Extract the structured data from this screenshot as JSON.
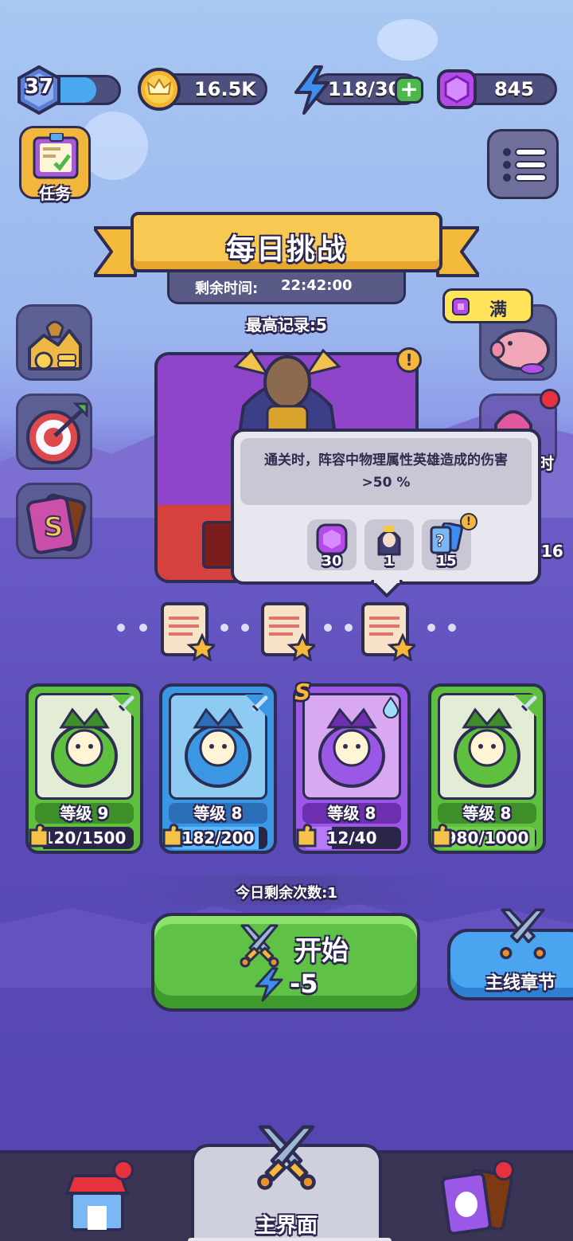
{
  "player": {
    "level": "37",
    "xp_fraction": 0.72
  },
  "resources": {
    "gold": "16.5K",
    "energy": "118/30",
    "gems": "845"
  },
  "left_buttons": {
    "tasks_label": "任务"
  },
  "title_banner": {
    "title": "每日挑战",
    "time_label": "剩余时间:",
    "time_value": "22:42:00"
  },
  "best_record": "最高记录:5",
  "piggy_bank": {
    "label": "满"
  },
  "tooltip": {
    "text": "通关时，阵容中物理属性英雄造成的伤害>50 %",
    "rewards": [
      {
        "icon": "purple-gem-icon",
        "count": "30"
      },
      {
        "icon": "hero-shard-icon",
        "count": "1"
      },
      {
        "icon": "mystery-card-icon",
        "count": "15"
      }
    ]
  },
  "side_partial_text": "时",
  "side_partial_number": "16",
  "hero_cards": [
    {
      "level": "等级 9",
      "progress": "120/1500",
      "fraction": 0.08,
      "theme": "green",
      "rank_badge": ""
    },
    {
      "level": "等级 8",
      "progress": "182/200",
      "fraction": 0.91,
      "theme": "blue",
      "rank_badge": ""
    },
    {
      "level": "等级 8",
      "progress": "12/40",
      "fraction": 0.3,
      "theme": "purple",
      "rank_badge": "S"
    },
    {
      "level": "等级 8",
      "progress": "980/1000",
      "fraction": 0.98,
      "theme": "green",
      "rank_badge": ""
    }
  ],
  "remaining_attempts": "今日剩余次数:1",
  "start_button": {
    "label": "开始",
    "cost": "-5"
  },
  "main_chapter_button": {
    "label": "主线章节"
  },
  "bottom_nav": {
    "home_label": "主界面"
  },
  "colors": {
    "green": "#5fbf3e",
    "blue": "#3b97e3",
    "purple": "#9b57e6",
    "gold": "#f5c64a"
  }
}
